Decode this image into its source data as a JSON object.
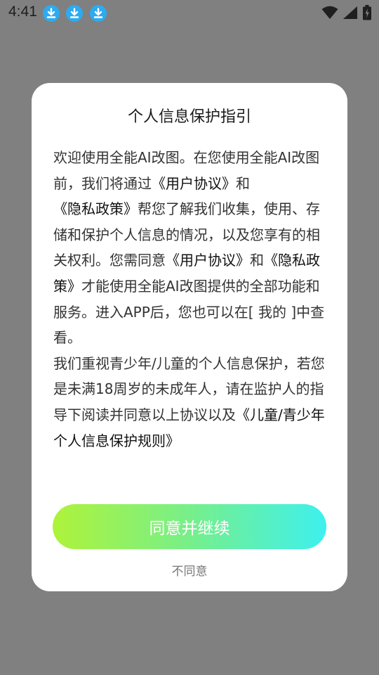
{
  "status_bar": {
    "time": "4:41",
    "download_notifications": [
      "download-icon",
      "download-icon",
      "download-icon"
    ],
    "right_icons": [
      "wifi-icon",
      "cell-signal-icon",
      "battery-charging-icon"
    ]
  },
  "dialog": {
    "title": "个人信息保护指引",
    "body": {
      "s1": "欢迎使用全能AI改图。在您使用全能AI改图前，我们将通过",
      "link_user_agreement_1": "《用户协议》",
      "s2": "和",
      "link_privacy_policy_1": "《隐私政策》",
      "s3": "帮您了解我们收集，使用、存储和保护个人信息的情况，以及您享有的相关权利。您需同意",
      "link_user_agreement_2": "《用户协议》",
      "s4": "和",
      "link_privacy_policy_2": "《隐私政策》",
      "s5": "才能使用全能AI改图提供的全部功能和服务。进入APP后，您也可以在[ 我的 ]中查看。",
      "s6": "我们重视青少年/儿童的个人信息保护，若您是未满18周岁的未成年人，请在监护人的指导下阅读并同意以上协议以及",
      "link_children_rules": "《儿童/青少年个人信息保护规则》"
    },
    "agree_button": "同意并继续",
    "disagree_link": "不同意"
  },
  "colors": {
    "scrim": "#7f807f",
    "dialog_background": "#ffffff",
    "button_gradient_start": "#aef33a",
    "button_gradient_end": "#3ef0ee",
    "download_badge": "#2eaaf0"
  }
}
